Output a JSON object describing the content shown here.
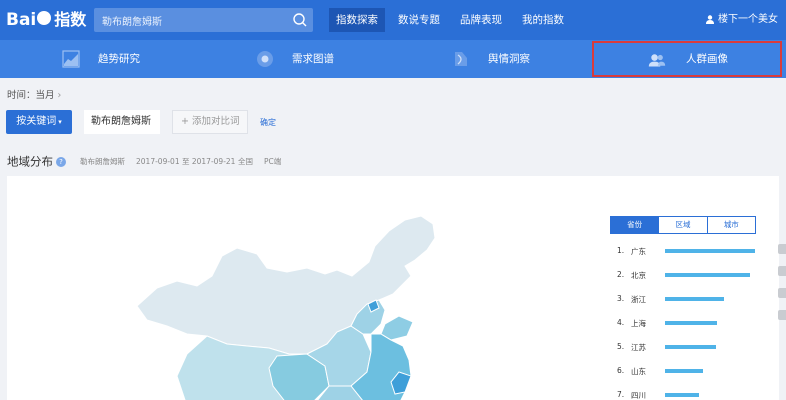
{
  "topbar": {
    "logo_text": "Bai",
    "logo_suffix": "指数",
    "search_value": "勒布朗詹姆斯",
    "nav": [
      "指数探索",
      "数说专题",
      "品牌表现",
      "我的指数"
    ],
    "user_name": "楼下一个美女",
    "accent": "#2b6fd6"
  },
  "subnav": {
    "items": [
      "趋势研究",
      "需求图谱",
      "舆情洞察",
      "人群画像"
    ],
    "active_index": 3
  },
  "time": {
    "label": "时间：当月"
  },
  "keywords": {
    "button_label": "按关键词",
    "keyword": "勒布朗詹姆斯",
    "add_label": "+ 添加对比词",
    "confirm_label": "确定"
  },
  "region": {
    "title": "地域分布",
    "help": "?",
    "keyword": "勒布朗詹姆斯",
    "date_range": "2017-09-01 至 2017-09-21",
    "scope": "全国",
    "device": "PC端"
  },
  "tabs": [
    "省份",
    "区域",
    "城市"
  ],
  "ranking": [
    {
      "rank": "1.",
      "name": "广东",
      "value": 100
    },
    {
      "rank": "2.",
      "name": "北京",
      "value": 94
    },
    {
      "rank": "3.",
      "name": "浙江",
      "value": 66
    },
    {
      "rank": "4.",
      "name": "上海",
      "value": 58
    },
    {
      "rank": "5.",
      "name": "江苏",
      "value": 57
    },
    {
      "rank": "6.",
      "name": "山东",
      "value": 42
    },
    {
      "rank": "7.",
      "name": "四川",
      "value": 38
    }
  ]
}
